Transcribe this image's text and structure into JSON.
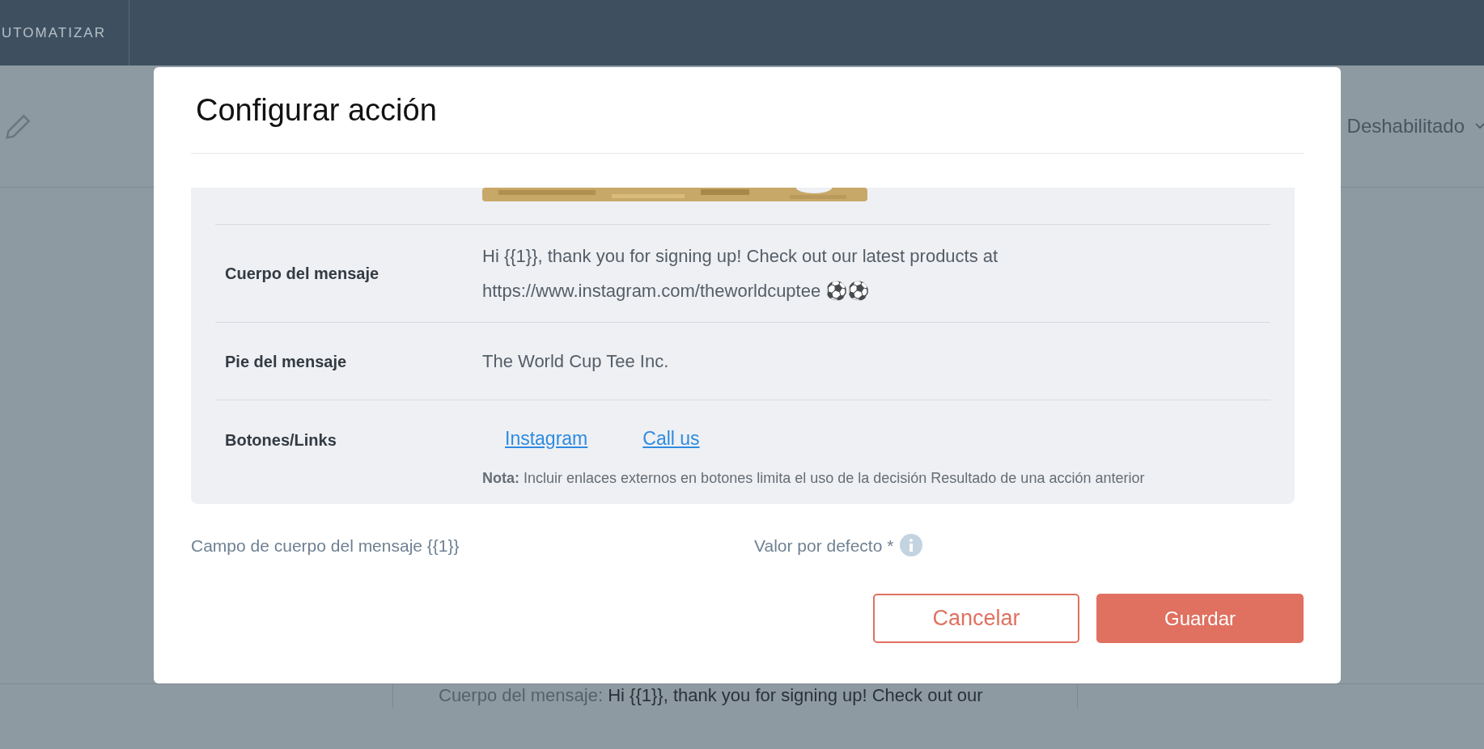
{
  "top_bar": {
    "nav_item": "UTOMATIZAR"
  },
  "background": {
    "status_select": "Deshabilitado",
    "preview_label": "Cuerpo del mensaje:",
    "preview_text": "Hi {{1}}, thank you for signing up! Check out our"
  },
  "dialog": {
    "title": "Configurar acción",
    "preview": {
      "rows": [
        {
          "label": "Cuerpo del mensaje",
          "lines": [
            "Hi {{1}}, thank you for signing up! Check out our latest products at",
            "https://www.instagram.com/theworldcuptee ⚽⚽"
          ]
        },
        {
          "label": "Pie del mensaje",
          "lines": [
            "The World Cup Tee Inc."
          ]
        }
      ],
      "buttons_row": {
        "label": "Botones/Links",
        "links": [
          "Instagram",
          "Call us"
        ],
        "note": "**Nota:** Incluir enlaces externos en botones limita el uso de la decisión Resultado de una acción anterior"
      }
    },
    "field_label": "Campo de cuerpo del mensaje {{1}}",
    "default_label": "Valor por defecto *",
    "cancel": "Cancelar",
    "save": "Guardar"
  }
}
